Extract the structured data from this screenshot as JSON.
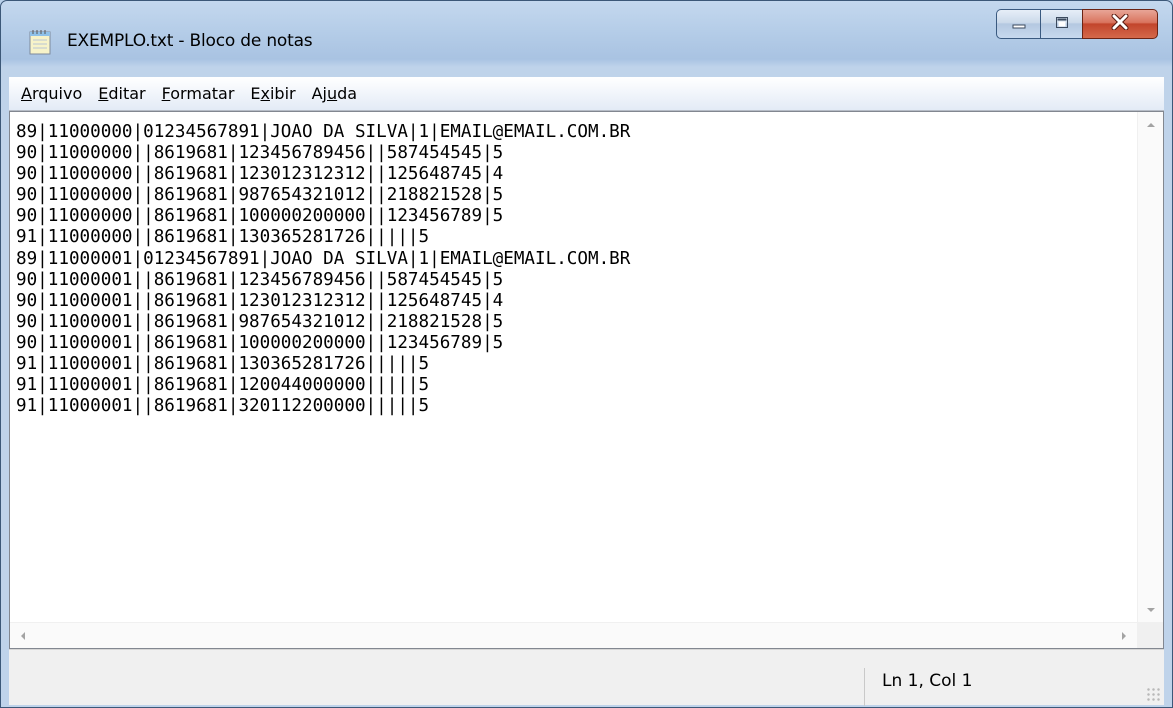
{
  "window": {
    "title": "EXEMPLO.txt - Bloco de notas"
  },
  "menu": [
    {
      "mnemonic": "A",
      "rest": "rquivo"
    },
    {
      "mnemonic": "E",
      "rest": "ditar"
    },
    {
      "mnemonic": "F",
      "rest": "ormatar"
    },
    {
      "before": "E",
      "mnemonic": "x",
      "rest": "ibir"
    },
    {
      "before": "Aj",
      "mnemonic": "u",
      "rest": "da"
    }
  ],
  "editor": {
    "content": "89|11000000|01234567891|JOAO DA SILVA|1|EMAIL@EMAIL.COM.BR\n90|11000000||8619681|123456789456||587454545|5\n90|11000000||8619681|123012312312||125648745|4\n90|11000000||8619681|987654321012||218821528|5\n90|11000000||8619681|100000200000||123456789|5\n91|11000000||8619681|130365281726|||||5\n89|11000001|01234567891|JOAO DA SILVA|1|EMAIL@EMAIL.COM.BR\n90|11000001||8619681|123456789456||587454545|5\n90|11000001||8619681|123012312312||125648745|4\n90|11000001||8619681|987654321012||218821528|5\n90|11000001||8619681|100000200000||123456789|5\n91|11000001||8619681|130365281726|||||5\n91|11000001||8619681|120044000000|||||5\n91|11000001||8619681|320112200000|||||5"
  },
  "statusbar": {
    "position": "Ln 1, Col 1"
  },
  "icons": {
    "app": "notepad-icon",
    "minimize": "minimize-icon",
    "maximize": "maximize-icon",
    "close": "close-icon"
  },
  "colors": {
    "close_button": "#c94a31",
    "window_frame": "#b9d1ea"
  }
}
